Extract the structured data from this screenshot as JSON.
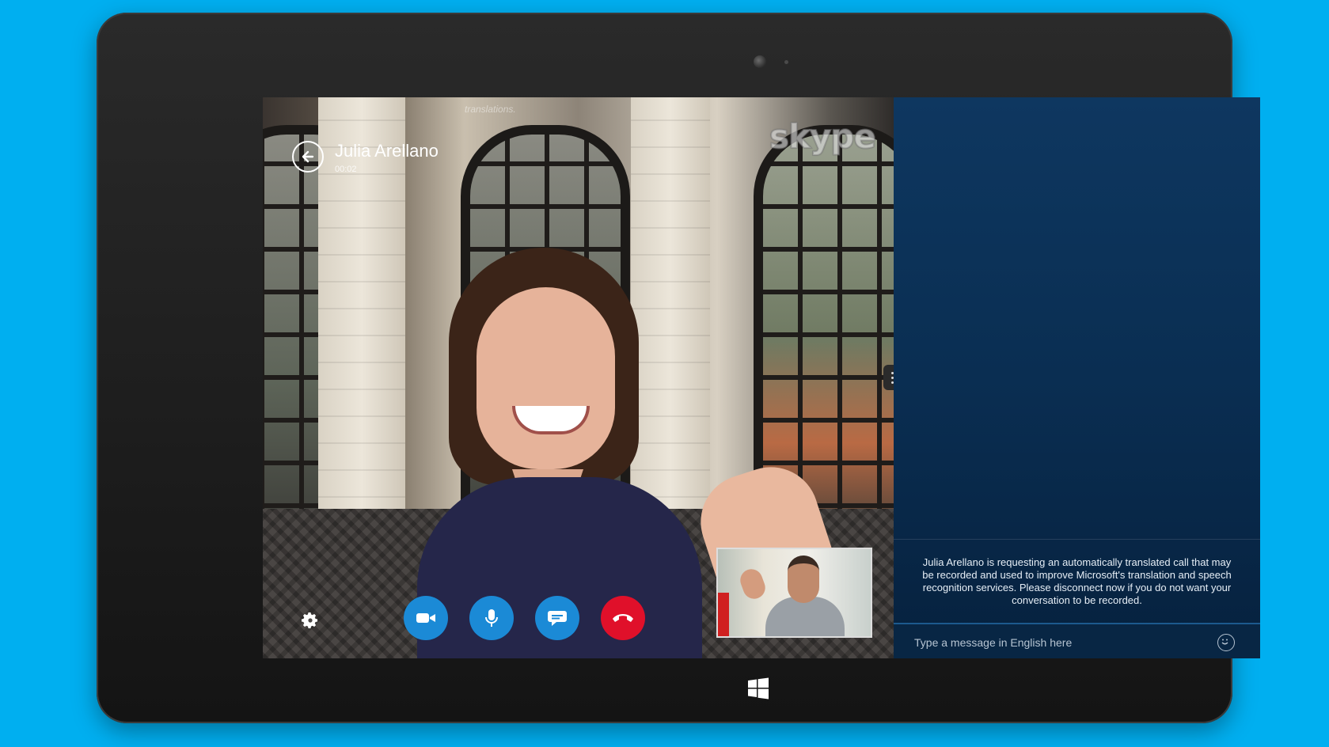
{
  "call": {
    "caller_name": "Julia Arellano",
    "timer": "00:02",
    "watermark_text": "translations.",
    "brand_logo_text": "skype"
  },
  "controls": {
    "settings_icon": "gear-icon",
    "video_icon": "video-camera-icon",
    "mic_icon": "microphone-icon",
    "chat_icon": "chat-bubble-icon",
    "end_call_icon": "hang-up-icon",
    "primary_color": "#1b8ad6",
    "end_call_color": "#e0102a"
  },
  "chat": {
    "notice": "Julia Arellano is requesting an automatically translated call that may be recorded and used to improve Microsoft's translation and speech recognition services. Please disconnect now if you do not want your conversation to be recorded.",
    "input_placeholder": "Type a message in English here",
    "emoji_icon": "smiley-icon"
  },
  "device": {
    "home_button_icon": "windows-logo-icon",
    "background_color": "#00aff0"
  }
}
